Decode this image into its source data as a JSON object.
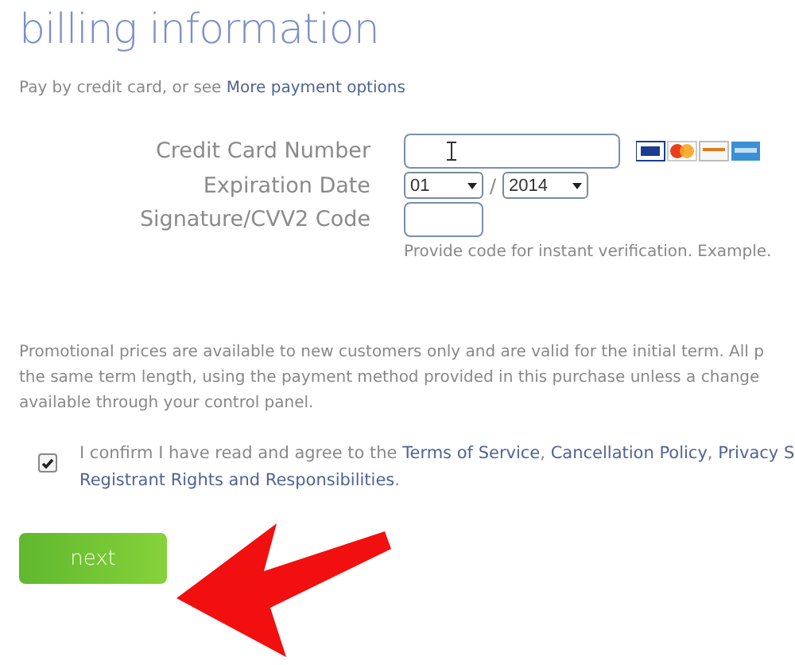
{
  "title": "billing information",
  "intro": [
    {
      "kind": "plain",
      "text": "Pay by credit card, or see "
    },
    {
      "kind": "link",
      "text": "More payment options"
    }
  ],
  "card_number": {
    "label": "Credit Card Number"
  },
  "expiration": {
    "label": "Expiration Date",
    "month": "01",
    "separator": "/",
    "year": "2014"
  },
  "cvv": {
    "label": "Signature/CVV2 Code",
    "hint": "Provide code for instant verification. Example."
  },
  "promo_lines": [
    "Promotional prices are available to new customers only and are valid for the initial term. All p",
    "the same term length, using the payment method provided in this purchase unless a change",
    "available through your control panel."
  ],
  "confirm": {
    "checked": true,
    "lines": [
      [
        {
          "kind": "plain",
          "text": "I confirm I have read and agree to the "
        },
        {
          "kind": "link",
          "text": "Terms of Service"
        },
        {
          "kind": "plain",
          "text": ", "
        },
        {
          "kind": "link",
          "text": "Cancellation Policy"
        },
        {
          "kind": "plain",
          "text": ", "
        },
        {
          "kind": "link",
          "text": "Privacy S"
        }
      ],
      [
        {
          "kind": "link",
          "text": "Registrant Rights and Responsibilities"
        },
        {
          "kind": "plain",
          "text": "."
        }
      ]
    ]
  },
  "next_button": "next"
}
